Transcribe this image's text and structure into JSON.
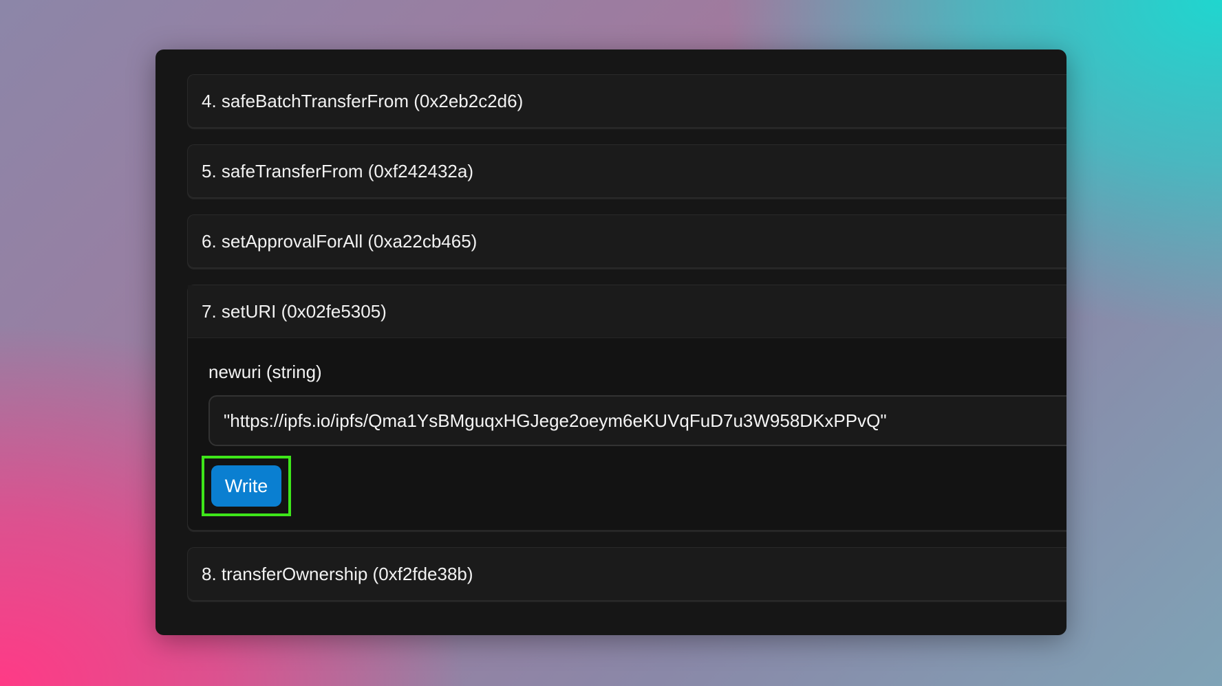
{
  "colors": {
    "accent_button": "#0a7fd1",
    "highlight_border": "#3ee61a",
    "panel_background": "#161616"
  },
  "functions": [
    {
      "index": "4.",
      "name": "safeBatchTransferFrom",
      "selector": "(0x2eb2c2d6)",
      "label": "4. safeBatchTransferFrom (0x2eb2c2d6)"
    },
    {
      "index": "5.",
      "name": "safeTransferFrom",
      "selector": "(0xf242432a)",
      "label": "5. safeTransferFrom (0xf242432a)"
    },
    {
      "index": "6.",
      "name": "setApprovalForAll",
      "selector": "(0xa22cb465)",
      "label": "6. setApprovalForAll (0xa22cb465)"
    },
    {
      "index": "7.",
      "name": "setURI",
      "selector": "(0x02fe5305)",
      "label": "7. setURI (0x02fe5305)",
      "expanded": true,
      "param_label": "newuri (string)",
      "param_value": "\"https://ipfs.io/ipfs/Qma1YsBMguqxHGJege2oeym6eKUVqFuD7u3W958DKxPPvQ\"",
      "write_label": "Write"
    },
    {
      "index": "8.",
      "name": "transferOwnership",
      "selector": "(0xf2fde38b)",
      "label": "8. transferOwnership (0xf2fde38b)"
    }
  ]
}
